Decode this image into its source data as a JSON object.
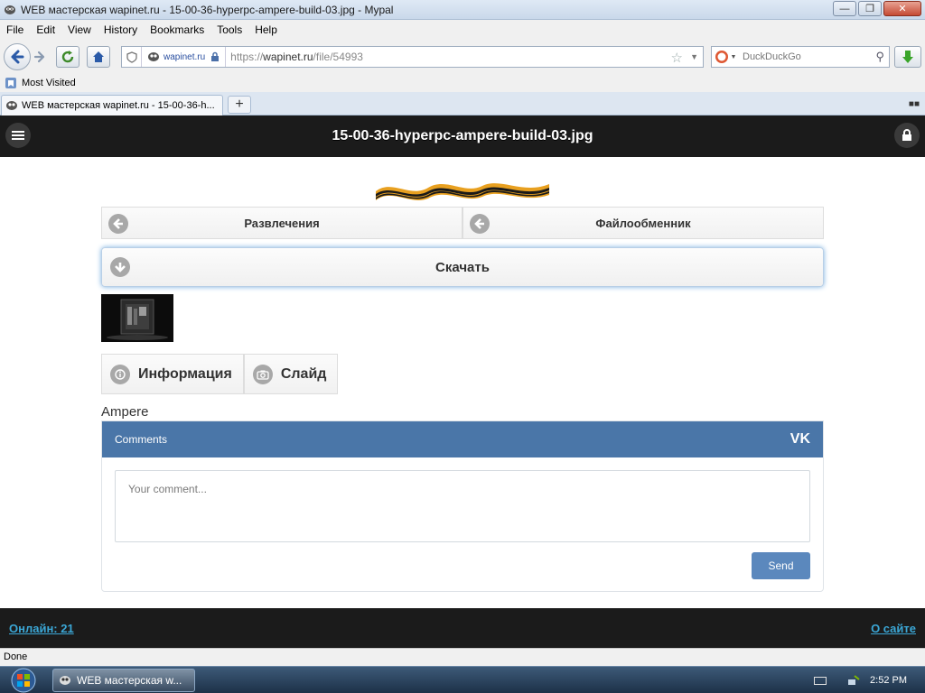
{
  "window": {
    "title": "WEB мастерская wapinet.ru - 15-00-36-hyperpc-ampere-build-03.jpg - Mypal"
  },
  "menu": {
    "file": "File",
    "edit": "Edit",
    "view": "View",
    "history": "History",
    "bookmarks": "Bookmarks",
    "tools": "Tools",
    "help": "Help"
  },
  "urlbar": {
    "site": "wapinet.ru",
    "scheme": "https://",
    "host": "wapinet.ru",
    "path": "/file/54993"
  },
  "search": {
    "placeholder": "DuckDuckGo"
  },
  "bookmarks": {
    "most_visited": "Most Visited"
  },
  "tab": {
    "label": "WEB мастерская wapinet.ru - 15-00-36-h..."
  },
  "page": {
    "title": "15-00-36-hyperpc-ampere-build-03.jpg",
    "nav_left": "Развлечения",
    "nav_right": "Файлообменник",
    "download": "Скачать",
    "info": "Информация",
    "slide": "Слайд",
    "image_name": "Ampere"
  },
  "comments": {
    "header": "Comments",
    "logo": "VK",
    "placeholder": "Your comment...",
    "send": "Send"
  },
  "footer": {
    "online": "Онлайн: 21",
    "about": "О сайте"
  },
  "status": {
    "text": "Done"
  },
  "taskbar": {
    "task_label": "WEB мастерская w...",
    "clock": "2:52 PM"
  },
  "colors": {
    "header_bg": "#1b1b1b",
    "vk_blue": "#4a76a8",
    "link": "#3ba7d6",
    "send_btn": "#5b88bd"
  }
}
